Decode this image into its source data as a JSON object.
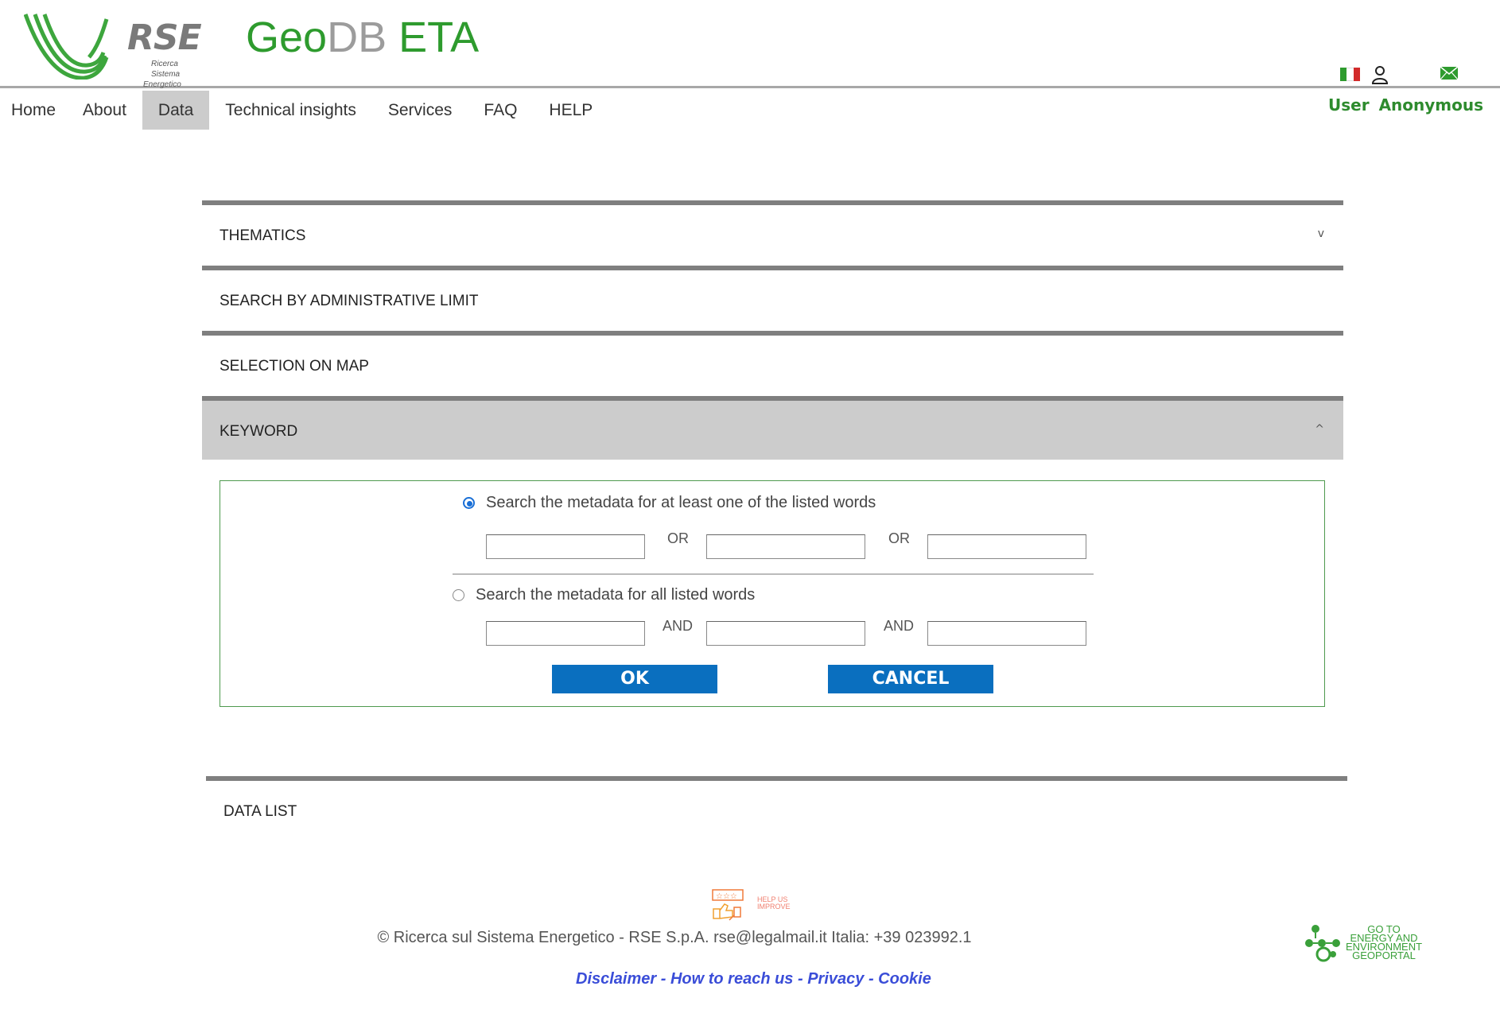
{
  "header": {
    "logo_text": "RSE",
    "logo_sub": [
      "Ricerca",
      "Sistema",
      "Energetico"
    ],
    "title_part1": "Geo",
    "title_part2": "DB",
    "title_part3": "ETA",
    "user_label": "User",
    "user_name": "Anonymous",
    "icons": [
      "flag-italy-icon",
      "user-icon",
      "mail-icon"
    ]
  },
  "nav": {
    "items": [
      {
        "label": "Home",
        "active": false
      },
      {
        "label": "About",
        "active": false
      },
      {
        "label": "Data",
        "active": true
      },
      {
        "label": "Technical insights",
        "active": false
      },
      {
        "label": "Services",
        "active": false
      },
      {
        "label": "FAQ",
        "active": false
      },
      {
        "label": "HELP",
        "active": false
      }
    ]
  },
  "accordion": {
    "thematics": {
      "label": "THEMATICS",
      "chevron": "v"
    },
    "admin_limit": {
      "label": "SEARCH BY ADMINISTRATIVE LIMIT"
    },
    "map_selection": {
      "label": "SELECTION ON MAP"
    },
    "keyword": {
      "label": "KEYWORD",
      "chevron": "^"
    }
  },
  "keyword_panel": {
    "option_any": {
      "label": "Search the metadata for at least one of the listed words",
      "selected": true
    },
    "option_all": {
      "label": "Search the metadata for all listed words",
      "selected": false
    },
    "op_or": "OR",
    "op_and": "AND",
    "any_inputs": [
      "",
      "",
      ""
    ],
    "all_inputs": [
      "",
      "",
      ""
    ],
    "ok_label": "OK",
    "cancel_label": "CANCEL"
  },
  "data_list": {
    "label": "DATA LIST"
  },
  "footer": {
    "help_improve": [
      "HELP US",
      "IMPROVE"
    ],
    "copyright": "© Ricerca sul Sistema Energetico - RSE S.p.A. rse@legalmail.it Italia: +39 023992.1",
    "links": [
      "Disclaimer",
      "How to reach us",
      "Privacy",
      "Cookie"
    ],
    "separator": " - ",
    "geoportal": [
      "Go to",
      "ENERGY AND",
      "ENVIRONMENT",
      "GEOPORTAL"
    ]
  },
  "colors": {
    "brand_green": "#2e9b2e",
    "title_gray": "#9c9c9c",
    "button_blue": "#0a6fbf",
    "link_blue": "#3a4dd8",
    "panel_border": "#4e9a4e"
  }
}
